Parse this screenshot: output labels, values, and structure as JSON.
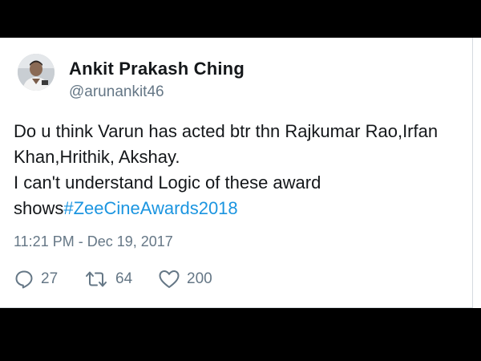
{
  "tweet": {
    "author": {
      "display_name": "Ankit Prakash Ching",
      "handle": "@arunankit46",
      "avatar_icon": "profile-photo"
    },
    "text_lines": [
      "Do u think Varun has acted btr thn Rajkumar Rao,Irfan",
      "Khan,Hrithik, Akshay.",
      "I can't understand Logic of these award"
    ],
    "text_last_line_prefix": "shows",
    "hashtag": "#ZeeCineAwards2018",
    "timestamp": "11:21 PM - Dec 19, 2017",
    "actions": {
      "replies": {
        "icon": "reply-icon",
        "count": "27"
      },
      "retweets": {
        "icon": "retweet-icon",
        "count": "64"
      },
      "likes": {
        "icon": "heart-icon",
        "count": "200"
      }
    }
  },
  "colors": {
    "text": "#14171a",
    "secondary_text": "#657786",
    "link": "#1b95e0",
    "border": "#d6dbe0",
    "background": "#ffffff",
    "letterbox": "#000000"
  }
}
